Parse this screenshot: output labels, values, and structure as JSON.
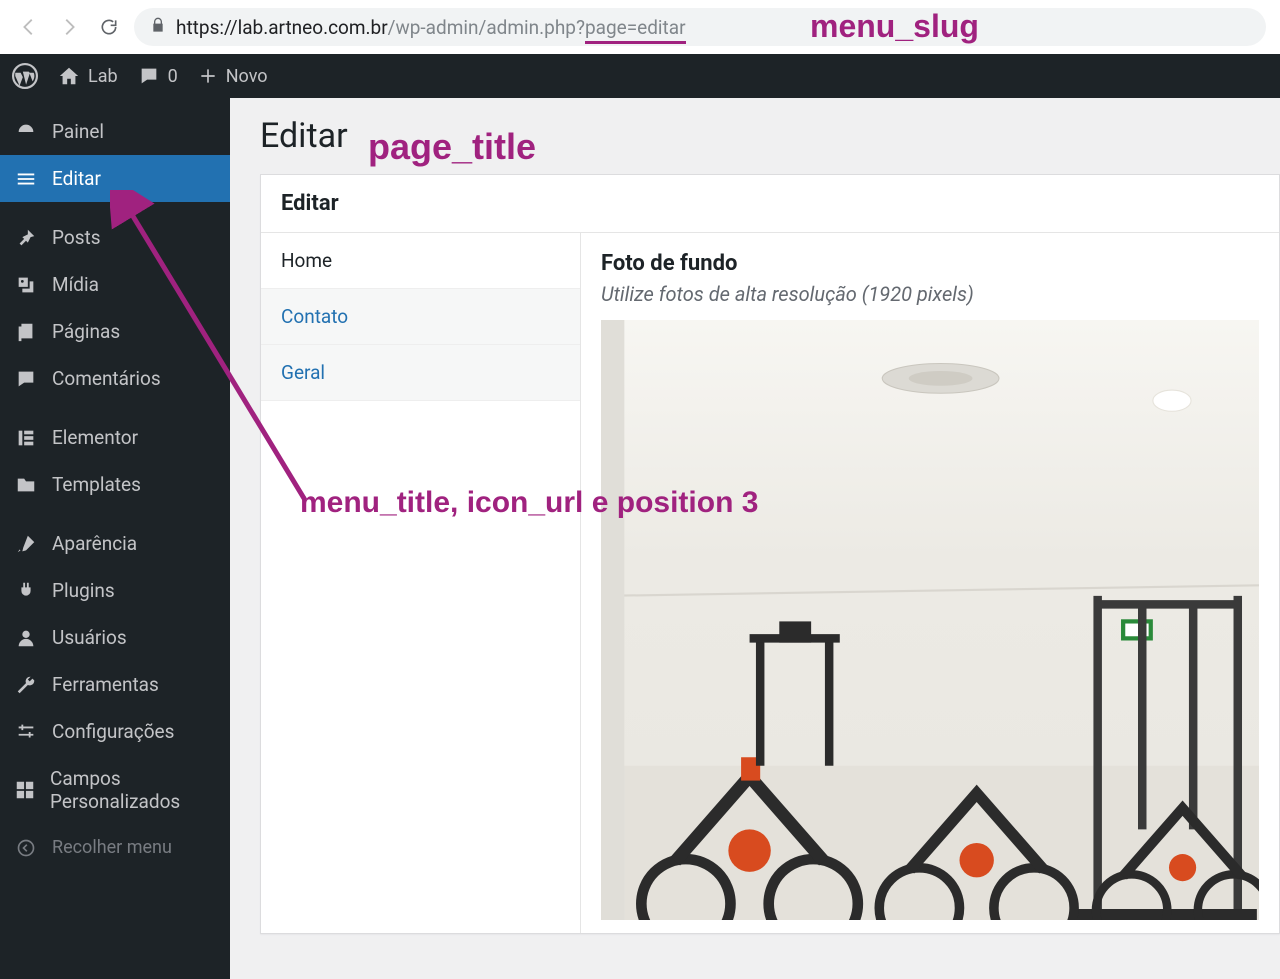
{
  "browser": {
    "url_host": "https://lab.artneo.com.br",
    "url_path": "/wp-admin/admin.php?",
    "url_query": "page=editar"
  },
  "adminbar": {
    "site_name": "Lab",
    "comments_count": "0",
    "new_label": "Novo"
  },
  "sidebar": {
    "items": [
      {
        "label": "Painel",
        "icon": "dashboard"
      },
      {
        "label": "Editar",
        "icon": "menu",
        "current": true
      },
      {
        "label": "Posts",
        "icon": "pin"
      },
      {
        "label": "Mídia",
        "icon": "media"
      },
      {
        "label": "Páginas",
        "icon": "pages"
      },
      {
        "label": "Comentários",
        "icon": "comment"
      },
      {
        "label": "Elementor",
        "icon": "elementor"
      },
      {
        "label": "Templates",
        "icon": "folder"
      },
      {
        "label": "Aparência",
        "icon": "brush"
      },
      {
        "label": "Plugins",
        "icon": "plug"
      },
      {
        "label": "Usuários",
        "icon": "user"
      },
      {
        "label": "Ferramentas",
        "icon": "wrench"
      },
      {
        "label": "Configurações",
        "icon": "sliders"
      },
      {
        "label": "Campos Personalizados",
        "icon": "grid"
      }
    ],
    "collapse_label": "Recolher menu"
  },
  "page": {
    "heading": "Editar",
    "metabox_title": "Editar",
    "tabs": [
      {
        "label": "Home",
        "active": true
      },
      {
        "label": "Contato"
      },
      {
        "label": "Geral"
      }
    ],
    "field_label": "Foto de fundo",
    "field_desc": "Utilize fotos de alta resolução (1920 pixels)"
  },
  "annotations": {
    "menu_slug": "menu_slug",
    "page_title": "page_title",
    "menu_title_line": "menu_title, icon_url e position 3"
  }
}
